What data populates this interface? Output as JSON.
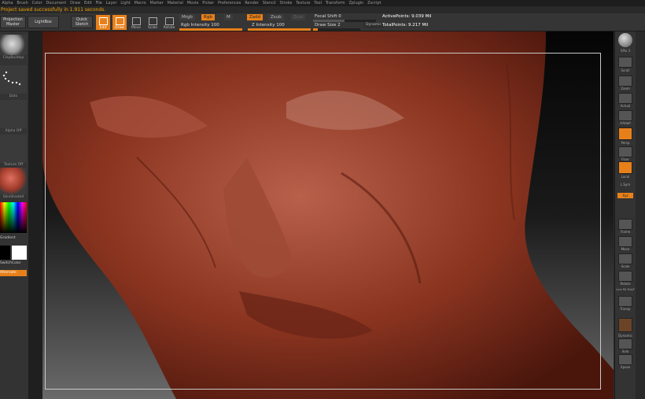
{
  "menu": [
    "Alpha",
    "Brush",
    "Color",
    "Document",
    "Draw",
    "Edit",
    "File",
    "Layer",
    "Light",
    "Macro",
    "Marker",
    "Material",
    "Movie",
    "Picker",
    "Preferences",
    "Render",
    "Stencil",
    "Stroke",
    "Texture",
    "Tool",
    "Transform",
    "Zplugin",
    "Zscript"
  ],
  "status_message": "Project saved successfully in 1.911 seconds.",
  "topbar": {
    "projection_master": "Projection\nMaster",
    "lightbox": "LightBox",
    "quick_sketch": "Quick\nSketch",
    "tools": [
      "Edit",
      "Draw",
      "Move",
      "Scale",
      "Rotate"
    ],
    "mrgb": "Mrgb",
    "rgb": "Rgb",
    "m": "M",
    "rgb_intensity": "Rgb Intensity 100",
    "zadd": "Zadd",
    "zsub": "Zsub",
    "zcut": "Zcut",
    "z_intensity": "Z Intensity 100",
    "focal_shift": "Focal Shift 0",
    "draw_size": "Draw Size 2",
    "dynamic": "Dynamic",
    "active_points": "ActivePoints: 9.039 Mil",
    "total_points": "TotalPoints: 9.217 Mil"
  },
  "left": {
    "brush_label": "ClayBuildup",
    "stroke_label": "Dots",
    "alpha_label": "Alpha Off",
    "texture_label": "Texture Off",
    "material_label": "SkinShade4",
    "gradient_label": "Gradient",
    "switch_label": "SwitchColor",
    "alternate_label": "Alternate"
  },
  "right": {
    "items": [
      "SPix 3",
      "Scroll",
      "Zoom",
      "Actual",
      "AAHalf",
      "Persp",
      "Floor",
      "Local",
      "L.Sym",
      "Xyz",
      "Frame",
      "Move",
      "Scale",
      "Rotate",
      "Line Fill PolyF",
      "Transp",
      "Dynamic",
      "Solo",
      "Xpose"
    ]
  },
  "colors": {
    "accent": "#e8801a",
    "status": "#f0a000",
    "sculpt": "#8a3420"
  }
}
